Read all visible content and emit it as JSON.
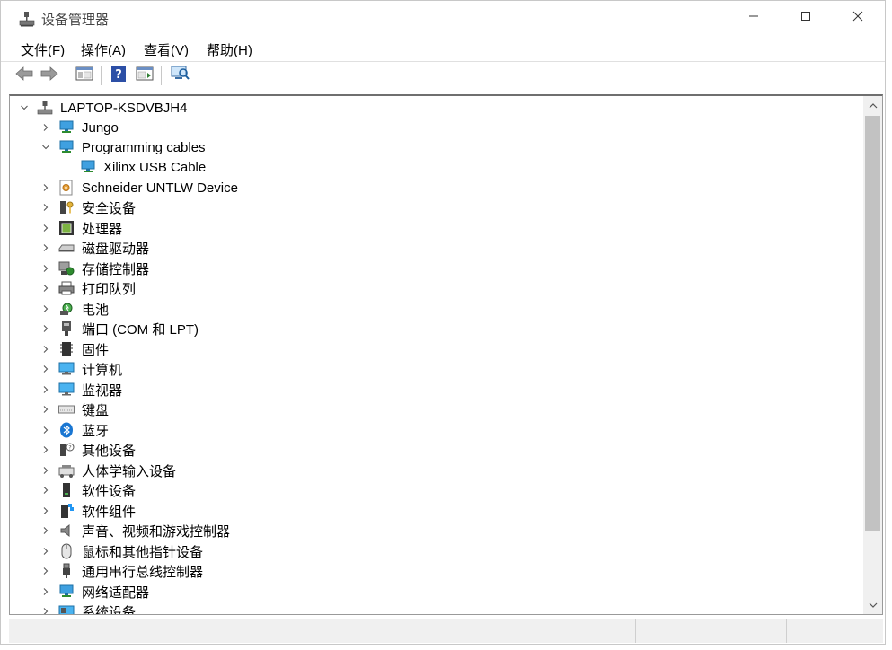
{
  "window": {
    "title": "设备管理器",
    "app_icon": "device-manager-icon"
  },
  "window_controls": {
    "minimize": "minimize-icon",
    "maximize": "maximize-icon",
    "close": "close-icon"
  },
  "menu": [
    {
      "label": "文件(F)"
    },
    {
      "label": "操作(A)"
    },
    {
      "label": "查看(V)"
    },
    {
      "label": "帮助(H)"
    }
  ],
  "toolbar": [
    {
      "name": "back",
      "icon": "back-arrow-icon"
    },
    {
      "name": "forward",
      "icon": "forward-arrow-icon"
    },
    {
      "name": "show-hide-console-tree",
      "icon": "console-tree-icon"
    },
    {
      "name": "help",
      "icon": "help-icon"
    },
    {
      "name": "properties",
      "icon": "properties-pane-icon"
    },
    {
      "name": "scan-hardware",
      "icon": "scan-hardware-icon"
    }
  ],
  "tree": {
    "root": {
      "label": "LAPTOP-KSDVBJH4",
      "expanded": true,
      "icon": "computer-tree-root-icon"
    },
    "items": [
      {
        "label": "Jungo",
        "level": 1,
        "expanded": false,
        "icon": "network-monitor-icon"
      },
      {
        "label": "Programming cables",
        "level": 1,
        "expanded": true,
        "icon": "network-monitor-icon"
      },
      {
        "label": "Xilinx USB Cable",
        "level": 2,
        "expanded": null,
        "icon": "network-monitor-icon"
      },
      {
        "label": "Schneider UNTLW Device",
        "level": 1,
        "expanded": false,
        "icon": "gear-device-icon"
      },
      {
        "label": "安全设备",
        "level": 1,
        "expanded": false,
        "icon": "security-key-icon"
      },
      {
        "label": "处理器",
        "level": 1,
        "expanded": false,
        "icon": "processor-chip-icon"
      },
      {
        "label": "磁盘驱动器",
        "level": 1,
        "expanded": false,
        "icon": "disk-drive-icon"
      },
      {
        "label": "存储控制器",
        "level": 1,
        "expanded": false,
        "icon": "storage-controller-icon"
      },
      {
        "label": "打印队列",
        "level": 1,
        "expanded": false,
        "icon": "printer-icon"
      },
      {
        "label": "电池",
        "level": 1,
        "expanded": false,
        "icon": "battery-icon"
      },
      {
        "label": "端口 (COM 和 LPT)",
        "level": 1,
        "expanded": false,
        "icon": "port-connector-icon"
      },
      {
        "label": "固件",
        "level": 1,
        "expanded": false,
        "icon": "firmware-chip-icon"
      },
      {
        "label": "计算机",
        "level": 1,
        "expanded": false,
        "icon": "computer-monitor-icon"
      },
      {
        "label": "监视器",
        "level": 1,
        "expanded": false,
        "icon": "computer-monitor-icon"
      },
      {
        "label": "键盘",
        "level": 1,
        "expanded": false,
        "icon": "keyboard-icon"
      },
      {
        "label": "蓝牙",
        "level": 1,
        "expanded": false,
        "icon": "bluetooth-icon"
      },
      {
        "label": "其他设备",
        "level": 1,
        "expanded": false,
        "icon": "unknown-device-icon"
      },
      {
        "label": "人体学输入设备",
        "level": 1,
        "expanded": false,
        "icon": "hid-device-icon"
      },
      {
        "label": "软件设备",
        "level": 1,
        "expanded": false,
        "icon": "software-device-icon"
      },
      {
        "label": "软件组件",
        "level": 1,
        "expanded": false,
        "icon": "software-component-icon"
      },
      {
        "label": "声音、视频和游戏控制器",
        "level": 1,
        "expanded": false,
        "icon": "speaker-icon"
      },
      {
        "label": "鼠标和其他指针设备",
        "level": 1,
        "expanded": false,
        "icon": "mouse-icon"
      },
      {
        "label": "通用串行总线控制器",
        "level": 1,
        "expanded": false,
        "icon": "usb-plug-icon"
      },
      {
        "label": "网络适配器",
        "level": 1,
        "expanded": false,
        "icon": "network-adapter-icon"
      },
      {
        "label": "系统设备",
        "level": 1,
        "expanded": false,
        "icon": "system-device-icon"
      }
    ]
  },
  "colors": {
    "selection": "#cce8ff",
    "accent": "#0078d7",
    "window_border": "#c8c8c8",
    "scrollbar_thumb": "#c2c2c2"
  }
}
